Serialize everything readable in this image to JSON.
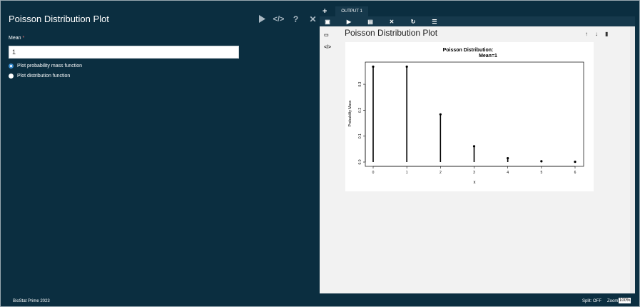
{
  "app": {
    "title": "Poisson Distribution Plot",
    "status_brand": "BioStat Prime 2023",
    "split": "Split: OFF",
    "zoom_label": "Zoom:",
    "zoom_value": "100%"
  },
  "left": {
    "tools": [
      "run-icon",
      "code-icon",
      "help-icon",
      "close-icon"
    ],
    "mean_label": "Mean",
    "mean_required": "*",
    "mean_value": "1",
    "options": [
      {
        "label": "Plot probability mass function",
        "selected": true
      },
      {
        "label": "Plot distribution function",
        "selected": false
      }
    ]
  },
  "right": {
    "add_tab": "+",
    "tab_label": "OUTPUT 1",
    "toolbar": [
      "new-icon",
      "open-icon",
      "delete-icon",
      "close-icon",
      "refresh-icon",
      "list-icon"
    ],
    "output_title": "Poisson Distribution Plot",
    "card_actions": [
      "↑",
      "↓",
      "🗑"
    ]
  },
  "chart_data": {
    "type": "line",
    "title": "Poisson  Distribution:",
    "subtitle": "Mean=1",
    "xlabel": "x",
    "ylabel": "Probability Mass",
    "x": [
      0,
      1,
      2,
      3,
      4,
      5,
      6
    ],
    "values": [
      0.368,
      0.368,
      0.184,
      0.061,
      0.015,
      0.003,
      0.001
    ],
    "xticks": [
      "0",
      "1",
      "2",
      "3",
      "4",
      "5",
      "6"
    ],
    "yticks": [
      "0.0",
      "0.1",
      "0.2",
      "0.3"
    ],
    "ylim": [
      0,
      0.38
    ],
    "xlim": [
      0,
      6
    ]
  }
}
